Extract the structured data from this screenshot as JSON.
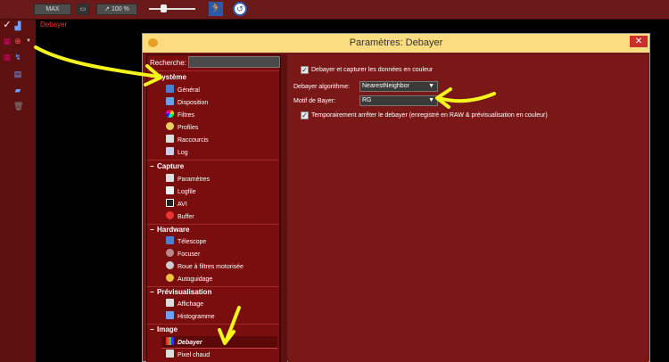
{
  "toolbar": {
    "max_label": "MAX",
    "zoom_value": "100 %",
    "icons": [
      "monitor-icon",
      "zoom-icon",
      "slider",
      "runner-icon",
      "history-icon"
    ],
    "active_tab": "Debayer"
  },
  "left_column": {
    "icons": [
      "check-icon",
      "histogram-icon",
      "crosshair-icon",
      "chevron-down-icon",
      "grid-icon",
      "chart-icon",
      "calendar-icon",
      "chat-icon",
      "trash-icon"
    ]
  },
  "dialog": {
    "title": "Paramètres: Debayer",
    "close_label": "✕",
    "search_label": "Recherche:",
    "search_value": "",
    "tree": [
      {
        "category": "Système",
        "items": [
          "Général",
          "Disposition",
          "Filtres",
          "Profiles",
          "Raccourcis",
          "Log"
        ]
      },
      {
        "category": "Capture",
        "items": [
          "Paramètres",
          "Logfile",
          "AVI",
          "Buffer"
        ]
      },
      {
        "category": "Hardware",
        "items": [
          "Télescope",
          "Focuser",
          "Roue à filtres motorisée",
          "Autoguidage"
        ]
      },
      {
        "category": "Prévisualisation",
        "items": [
          "Affichage",
          "Histogramme"
        ]
      },
      {
        "category": "Image",
        "items": [
          "Debayer",
          "Pixel chaud"
        ]
      }
    ],
    "selected_item": "Debayer",
    "settings": {
      "debayer_checkbox_label": "Debayer et capturer les données en couleur",
      "debayer_checked": true,
      "algorithm_label": "Debayer algorithme:",
      "algorithm_value": "NearestNeighbor",
      "pattern_label": "Motif de Bayer:",
      "pattern_value": "RG",
      "temp_checkbox_label": "Temporairement arrêter le debayer (enregistré en RAW & prévisualisation en couleur)",
      "temp_checked": true
    }
  },
  "colors": {
    "toolbar_bg": "#6b1a1a",
    "dialog_title_bg": "#fbdc80",
    "pane_bg": "#7a0e0e",
    "annotation": "#f5f51e"
  }
}
